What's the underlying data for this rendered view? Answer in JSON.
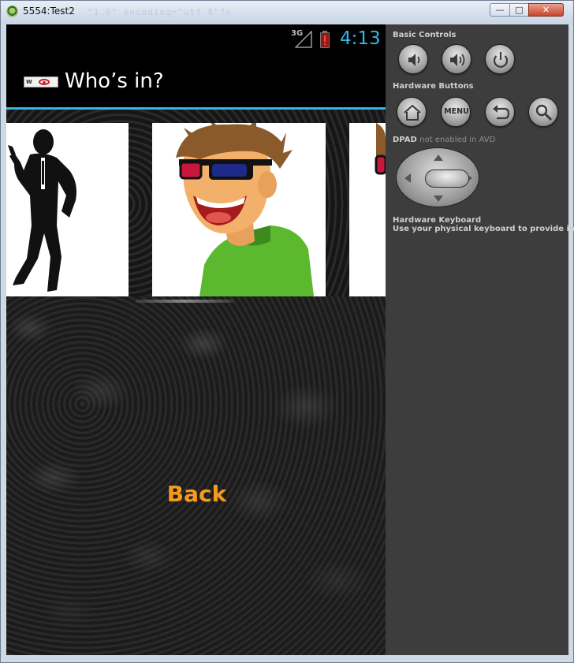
{
  "window": {
    "title": "5554:Test2",
    "background_code_ghost": "\"1.0\" encoding=\"utf-8\"?>",
    "buttons": {
      "minimize": "—",
      "maximize": "□",
      "close": "✕"
    }
  },
  "status_bar": {
    "network_label": "3G",
    "signal_icon": "signal-icon",
    "battery_icon": "battery-alert-icon",
    "time": "4:13",
    "clock_color": "#33b5e5"
  },
  "action_bar": {
    "logo_text": "WHO'S IN",
    "title": "Who’s in?",
    "divider_color": "#33b5e5"
  },
  "gallery": {
    "items": [
      {
        "name": "silhouette-man-photo"
      },
      {
        "name": "cartoon-man-3d-glasses-photo"
      },
      {
        "name": "partial-photo"
      }
    ]
  },
  "main": {
    "back_label": "Back",
    "back_color": "#f49b1b"
  },
  "controls": {
    "basic_controls_label": "Basic Controls",
    "hardware_buttons_label": "Hardware Buttons",
    "menu_button_label": "MENU",
    "dpad_label": "DPAD",
    "dpad_note": "not enabled in AVD",
    "keyboard_label": "Hardware Keyboard",
    "keyboard_note": "Use your physical keyboard to provide input"
  }
}
